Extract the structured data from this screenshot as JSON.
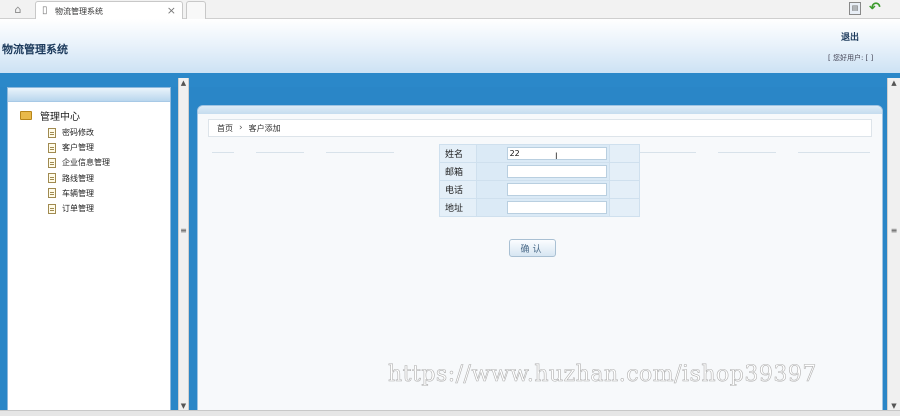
{
  "browser": {
    "home_icon": "home-icon",
    "tab_title": "物流管理系统",
    "tab_close": "×"
  },
  "header": {
    "app_title": "物流管理系统",
    "logout": "退出",
    "user_info": "[ 您好用户: [ ]"
  },
  "sidebar": {
    "root_label": "管理中心",
    "items": [
      {
        "label": "密码修改"
      },
      {
        "label": "客户管理"
      },
      {
        "label": "企业信息管理"
      },
      {
        "label": "路线管理"
      },
      {
        "label": "车辆管理"
      },
      {
        "label": "订单管理"
      }
    ]
  },
  "breadcrumb": {
    "home": "首页",
    "separator": "›",
    "current": "客户添加"
  },
  "form": {
    "fields": [
      {
        "label": "姓名",
        "value": "22"
      },
      {
        "label": "邮箱",
        "value": ""
      },
      {
        "label": "电话",
        "value": ""
      },
      {
        "label": "地址",
        "value": ""
      }
    ],
    "submit_label": "确认"
  },
  "watermark": "https://www.huzhan.com/ishop39397",
  "colors": {
    "accent_blue": "#2a86c7",
    "header_text": "#1c3a5c"
  }
}
